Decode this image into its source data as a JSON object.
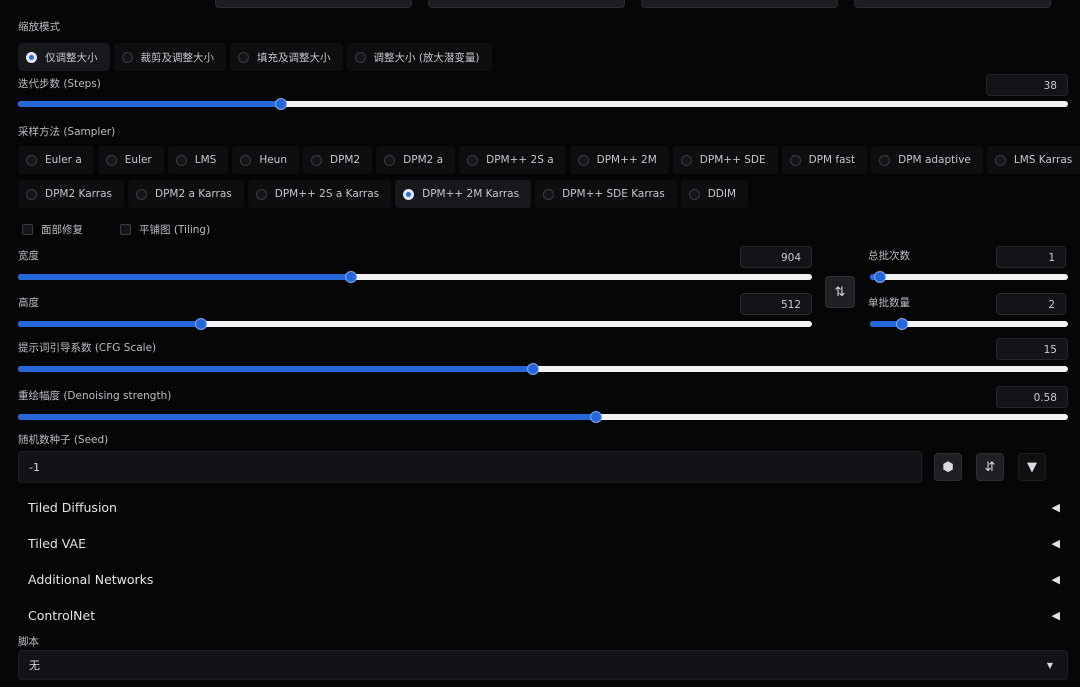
{
  "resize_mode": {
    "label": "缩放模式",
    "options": [
      "仅调整大小",
      "裁剪及调整大小",
      "填充及调整大小",
      "调整大小 (放大潜变量)"
    ],
    "selected_index": 0
  },
  "steps": {
    "label": "迭代步数 (Steps)",
    "value": "38",
    "fraction": 0.25
  },
  "sampler": {
    "label": "采样方法 (Sampler)",
    "row1": [
      "Euler a",
      "Euler",
      "LMS",
      "Heun",
      "DPM2",
      "DPM2 a",
      "DPM++ 2S a",
      "DPM++ 2M",
      "DPM++ SDE",
      "DPM fast",
      "DPM adaptive",
      "LMS Karras"
    ],
    "row2": [
      "DPM2 Karras",
      "DPM2 a Karras",
      "DPM++ 2S a Karras",
      "DPM++ 2M Karras",
      "DPM++ SDE Karras",
      "DDIM"
    ],
    "selected": "DPM++ 2M Karras"
  },
  "checkboxes": {
    "face_restore": "面部修复",
    "tiling": "平铺图 (Tiling)"
  },
  "width": {
    "label": "宽度",
    "value": "904",
    "fraction": 0.42
  },
  "height": {
    "label": "高度",
    "value": "512",
    "fraction": 0.23
  },
  "swap_icon": "swap-arrows-icon",
  "batch_count": {
    "label": "总批次数",
    "value": "1",
    "fraction": 0.05
  },
  "batch_size": {
    "label": "单批数量",
    "value": "2",
    "fraction": 0.16
  },
  "cfg_scale": {
    "label": "提示词引导系数 (CFG Scale)",
    "value": "15",
    "fraction": 0.49
  },
  "denoising": {
    "label": "重绘幅度 (Denoising strength)",
    "value": "0.58",
    "fraction": 0.55
  },
  "seed": {
    "label": "随机数种子 (Seed)",
    "value": "-1",
    "icons": [
      "dice-icon",
      "recycle-icon",
      "caret-down-icon"
    ]
  },
  "sections": [
    "Tiled Diffusion",
    "Tiled VAE",
    "Additional Networks",
    "ControlNet"
  ],
  "script": {
    "label": "脚本",
    "value": "无"
  },
  "colors": {
    "accent": "#2567d8",
    "track": "#f2f3f5",
    "background": "#060607"
  }
}
